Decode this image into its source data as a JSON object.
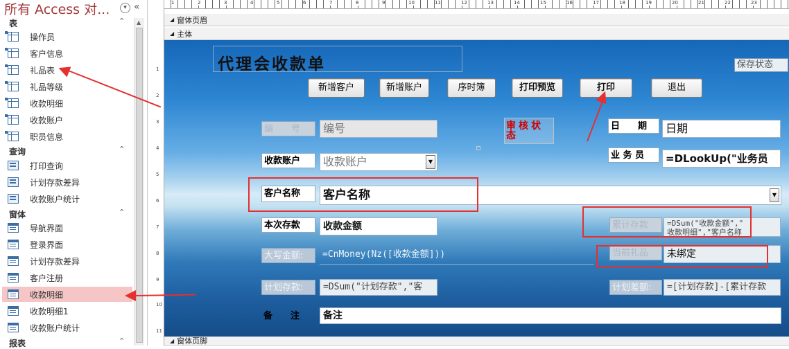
{
  "nav": {
    "title": "所有 Access 对...",
    "groups": [
      {
        "label": "表",
        "items": [
          "操作员",
          "客户信息",
          "礼品表",
          "礼品等级",
          "收款明细",
          "收款账户",
          "职员信息"
        ]
      },
      {
        "label": "查询",
        "items": [
          "打印查询",
          "计划存款差异",
          "收款账户统计"
        ]
      },
      {
        "label": "窗体",
        "items": [
          "导航界面",
          "登录界面",
          "计划存款差异",
          "客户注册",
          "收款明细",
          "收款明细1",
          "收款账户统计"
        ]
      },
      {
        "label": "报表",
        "items": []
      }
    ],
    "selected_item": "收款明细"
  },
  "ruler": {
    "top_numbers": [
      "1",
      "2",
      "3",
      "4",
      "5",
      "6",
      "7",
      "8",
      "9",
      "10",
      "11",
      "12",
      "13",
      "14",
      "15",
      "16",
      "17",
      "18",
      "19",
      "20",
      "21",
      "22",
      "23"
    ],
    "left_numbers": [
      "1",
      "2",
      "3",
      "4",
      "5",
      "6",
      "7",
      "8",
      "9",
      "10",
      "11"
    ]
  },
  "sections": {
    "header": "窗体页眉",
    "detail": "主体",
    "footer": "窗体页脚"
  },
  "form": {
    "title": "代理会收款单",
    "save_status": "保存状态",
    "buttons": {
      "add_customer": "新增客户",
      "add_account": "新增账户",
      "sequence": "序时簿",
      "print_preview": "打印预览",
      "print": "打印",
      "exit": "退出"
    },
    "stamp": "审核状态",
    "labels": {
      "number": "编　　号",
      "date": "日　　期",
      "account": "收款账户",
      "salesperson": "业 务 员",
      "customer": "客户名称",
      "amount": "本次存款",
      "cumulative": "累计存款",
      "uppercase": "大写金额:",
      "gift": "当前礼品",
      "planned": "计划存款:",
      "plan_diff": "计划差额:",
      "remark": "备　　注"
    },
    "fields": {
      "number": "编号",
      "date": "日期",
      "account": "收款账户",
      "salesperson": "=DLookUp(\"业务员",
      "customer": "客户名称",
      "amount": "收款金额",
      "cumulative_line1": "=DSum(\"收款金额\",\"",
      "cumulative_line2": "收款明细\",\"客户名称",
      "uppercase": "=CnMoney(Nz([收款金额]))",
      "gift": "未绑定",
      "planned": "=DSum(\"计划存款\",\"客",
      "plan_diff": "=[计划存款]-[累计存款",
      "remark": "备注"
    }
  },
  "colors": {
    "annotation_red": "#e53030",
    "nav_title": "#a4373a",
    "selected_bg": "#f6c6c6"
  }
}
